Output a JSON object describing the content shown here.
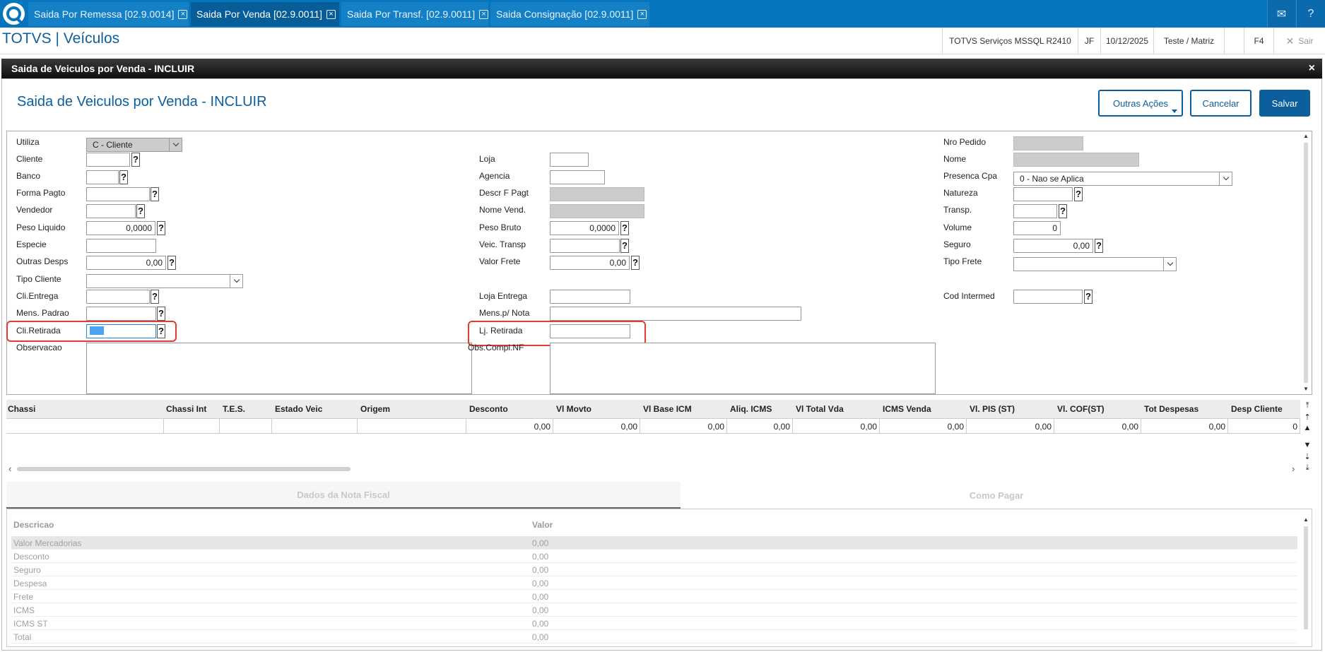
{
  "tabs": [
    {
      "label": "Saida Por Remessa [02.9.0014]"
    },
    {
      "label": "Saida Por Venda [02.9.0011]"
    },
    {
      "label": "Saida Por Transf. [02.9.0011]"
    },
    {
      "label": "Saida Consignação [02.9.0011]"
    }
  ],
  "header": {
    "app_title": "TOTVS | Veículos",
    "environment": "TOTVS Serviços MSSQL R2410",
    "user": "JF",
    "date": "10/12/2025",
    "branch": "Teste / Matriz",
    "shortcut": "F4",
    "exit_label": "Sair"
  },
  "dialog": {
    "bar_title": "Saida de Veiculos por Venda - INCLUIR",
    "form_title": "Saida de Veiculos por Venda - INCLUIR",
    "close_glyph": "×",
    "more_actions": "Outras Ações",
    "cancel": "Cancelar",
    "save": "Salvar"
  },
  "form": {
    "utiliza": {
      "label": "Utiliza",
      "value": "C - Cliente"
    },
    "cliente": {
      "label": "Cliente"
    },
    "banco": {
      "label": "Banco"
    },
    "forma_pagto": {
      "label": "Forma Pagto"
    },
    "vendedor": {
      "label": "Vendedor"
    },
    "peso_liquido": {
      "label": "Peso Liquido",
      "value": "0,0000"
    },
    "especie": {
      "label": "Especie"
    },
    "outras_desps": {
      "label": "Outras Desps",
      "value": "0,00"
    },
    "tipo_cliente": {
      "label": "Tipo Cliente"
    },
    "cli_entrega": {
      "label": "Cli.Entrega"
    },
    "mens_padrao": {
      "label": "Mens. Padrao"
    },
    "cli_retirada": {
      "label": "Cli.Retirada"
    },
    "observacao": {
      "label": "Observacao"
    },
    "loja": {
      "label": "Loja"
    },
    "agencia": {
      "label": "Agencia"
    },
    "descr_f_pagt": {
      "label": "Descr F Pagt"
    },
    "nome_vend": {
      "label": "Nome Vend."
    },
    "peso_bruto": {
      "label": "Peso Bruto",
      "value": "0,0000"
    },
    "veic_transp": {
      "label": "Veic. Transp"
    },
    "valor_frete": {
      "label": "Valor Frete",
      "value": "0,00"
    },
    "loja_entrega": {
      "label": "Loja Entrega"
    },
    "mens_nota": {
      "label": "Mens.p/ Nota"
    },
    "lj_retirada": {
      "label": "Lj. Retirada"
    },
    "obs_compl_nf": {
      "label": "Obs.Compl.NF"
    },
    "nro_pedido": {
      "label": "Nro Pedido"
    },
    "nome": {
      "label": "Nome"
    },
    "presenca_cpa": {
      "label": "Presenca Cpa",
      "value": "0 - Nao se Aplica"
    },
    "natureza": {
      "label": "Natureza"
    },
    "transp": {
      "label": "Transp."
    },
    "volume": {
      "label": "Volume",
      "value": "0"
    },
    "seguro": {
      "label": "Seguro",
      "value": "0,00"
    },
    "tipo_frete": {
      "label": "Tipo Frete"
    },
    "cod_intermed": {
      "label": "Cod Intermed"
    },
    "help_glyph": "?"
  },
  "grid": {
    "columns": [
      "Chassi",
      "Chassi Int",
      "T.E.S.",
      "Estado Veic",
      "Origem",
      "Desconto",
      "Vl Movto",
      "Vl Base ICM",
      "Aliq. ICMS",
      "Vl Total Vda",
      "ICMS Venda",
      "Vl. PIS (ST)",
      "Vl. COF(ST)",
      "Tot Despesas",
      "Desp Cliente"
    ],
    "row": [
      "",
      "",
      "",
      "",
      "",
      "0,00",
      "0,00",
      "0,00",
      "0,00",
      "0,00",
      "0,00",
      "0,00",
      "0,00",
      "0,00",
      "0"
    ]
  },
  "bottom": {
    "tabs": [
      "Dados da Nota Fiscal",
      "Como Pagar"
    ],
    "col_desc": "Descricao",
    "col_valor": "Valor",
    "rows": [
      {
        "desc": "Valor Mercadorias",
        "valor": "0,00"
      },
      {
        "desc": "Desconto",
        "valor": "0,00"
      },
      {
        "desc": "Seguro",
        "valor": "0,00"
      },
      {
        "desc": "Despesa",
        "valor": "0,00"
      },
      {
        "desc": "Frete",
        "valor": "0,00"
      },
      {
        "desc": "ICMS",
        "valor": "0,00"
      },
      {
        "desc": "ICMS ST",
        "valor": "0,00"
      },
      {
        "desc": "Total",
        "valor": "0,00"
      }
    ]
  },
  "colors": {
    "brand": "#0775bd",
    "accent": "#0c5f9c",
    "highlight": "#e53935",
    "focus": "#4aa3f0"
  }
}
